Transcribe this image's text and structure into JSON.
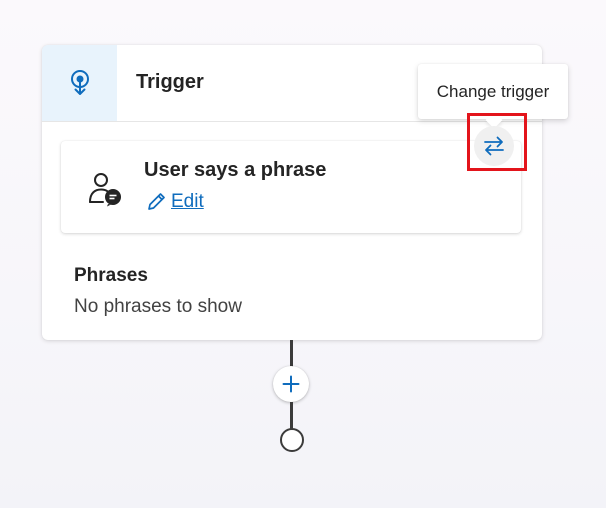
{
  "header": {
    "title": "Trigger",
    "icon": "trigger-icon"
  },
  "trigger": {
    "title": "User says a phrase",
    "edit_label": "Edit",
    "icon": "user-chat-icon",
    "edit_icon": "pencil-icon"
  },
  "phrases": {
    "title": "Phrases",
    "empty_text": "No phrases to show"
  },
  "tooltip": {
    "text": "Change trigger"
  },
  "change_button": {
    "icon": "swap-arrows-icon"
  },
  "add_button": {
    "icon": "plus-icon"
  },
  "colors": {
    "accent": "#0f6cbd",
    "header_icon_bg": "#e8f3fc",
    "highlight": "#e3141b"
  }
}
